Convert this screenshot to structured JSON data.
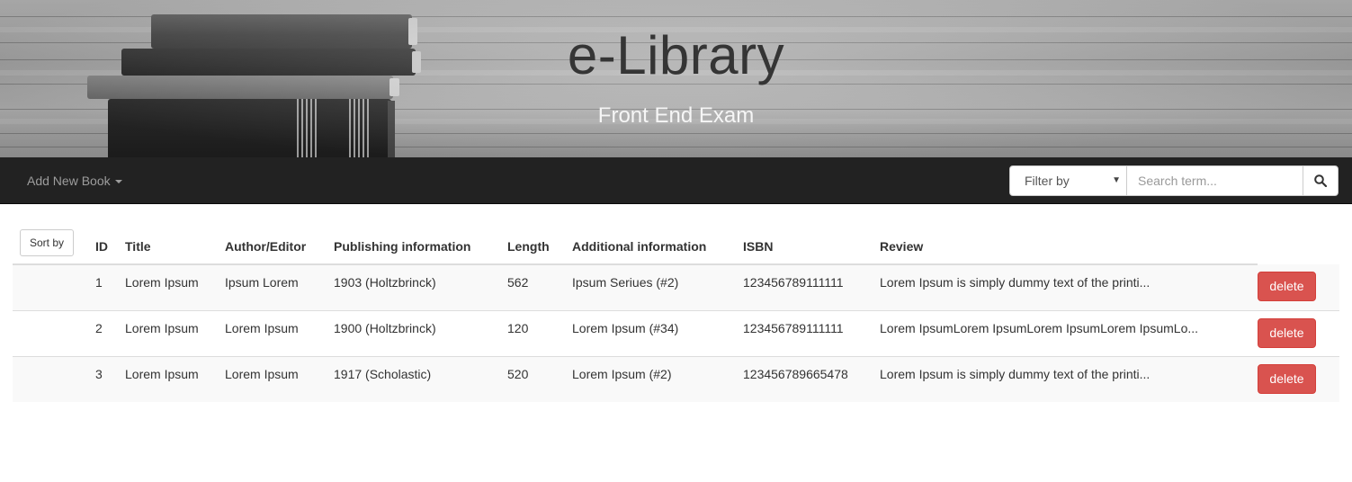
{
  "header": {
    "title": "e-Library",
    "subtitle": "Front End Exam"
  },
  "navbar": {
    "add_book_label": "Add New Book",
    "filter": {
      "selected": "Filter by"
    },
    "search": {
      "placeholder": "Search term..."
    }
  },
  "table": {
    "sort_label": "Sort by",
    "columns": [
      "ID",
      "Title",
      "Author/Editor",
      "Publishing information",
      "Length",
      "Additional information",
      "ISBN",
      "Review"
    ],
    "rows": [
      {
        "id": "1",
        "title": "Lorem Ipsum",
        "author": "Ipsum Lorem",
        "publishing": "1903 (Holtzbrinck)",
        "length": "562",
        "additional": "Ipsum Seriues (#2)",
        "isbn": "123456789111111",
        "review": "Lorem Ipsum is simply dummy text of the printi...",
        "action": "delete"
      },
      {
        "id": "2",
        "title": "Lorem Ipsum",
        "author": "Lorem Ipsum",
        "publishing": "1900 (Holtzbrinck)",
        "length": "120",
        "additional": "Lorem Ipsum (#34)",
        "isbn": "123456789111111",
        "review": "Lorem IpsumLorem IpsumLorem IpsumLorem IpsumLo...",
        "action": "delete"
      },
      {
        "id": "3",
        "title": "Lorem Ipsum",
        "author": "Lorem Ipsum",
        "publishing": "1917 (Scholastic)",
        "length": "520",
        "additional": "Lorem Ipsum (#2)",
        "isbn": "123456789665478",
        "review": "Lorem Ipsum is simply dummy text of the printi...",
        "action": "delete"
      }
    ]
  },
  "colors": {
    "navbar_bg": "#222222",
    "delete_button": "#d9534f",
    "striped_row": "#f9f9f9"
  },
  "icons": [
    "search-icon",
    "caret-down-icon",
    "books-stack-image"
  ]
}
